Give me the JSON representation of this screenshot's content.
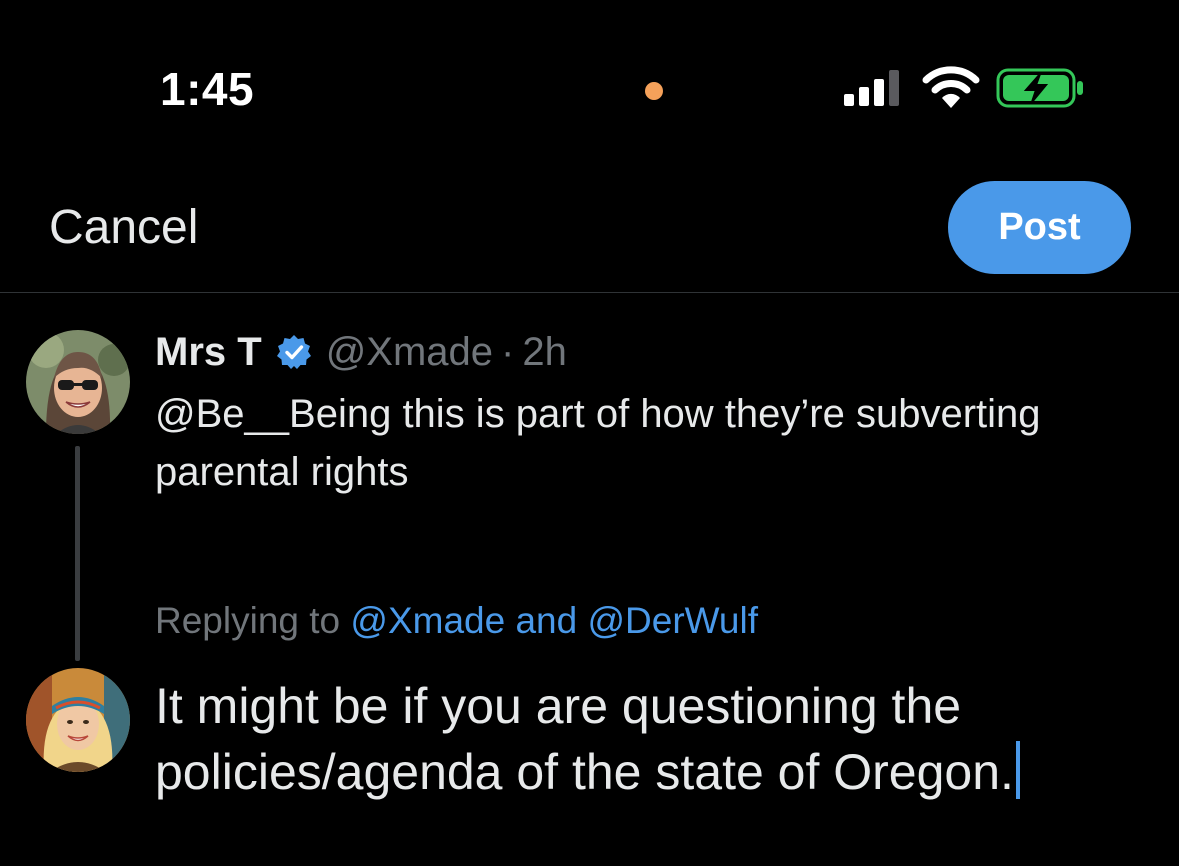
{
  "status_bar": {
    "time": "1:45",
    "recording_dot_color": "#f5a15a",
    "signal_icon": "cellular-signal-icon",
    "wifi_icon": "wifi-icon",
    "battery_icon": "battery-charging-icon",
    "battery_color": "#34c759"
  },
  "nav": {
    "cancel_label": "Cancel",
    "post_label": "Post",
    "accent": "#4a99e9"
  },
  "original_tweet": {
    "display_name": "Mrs T",
    "verified_icon": "verified-badge-icon",
    "handle": "@Xmade",
    "separator": "·",
    "age": "2h",
    "text": "@Be__Being  this is part of how they’re subverting parental rights"
  },
  "reply": {
    "replying_prefix": "Replying to ",
    "mention_1": "@Xmade",
    "and_word": " and ",
    "mention_2": "@DerWulf",
    "draft_text": "It might be if you are questioning the policies/agenda of the state of Oregon."
  }
}
